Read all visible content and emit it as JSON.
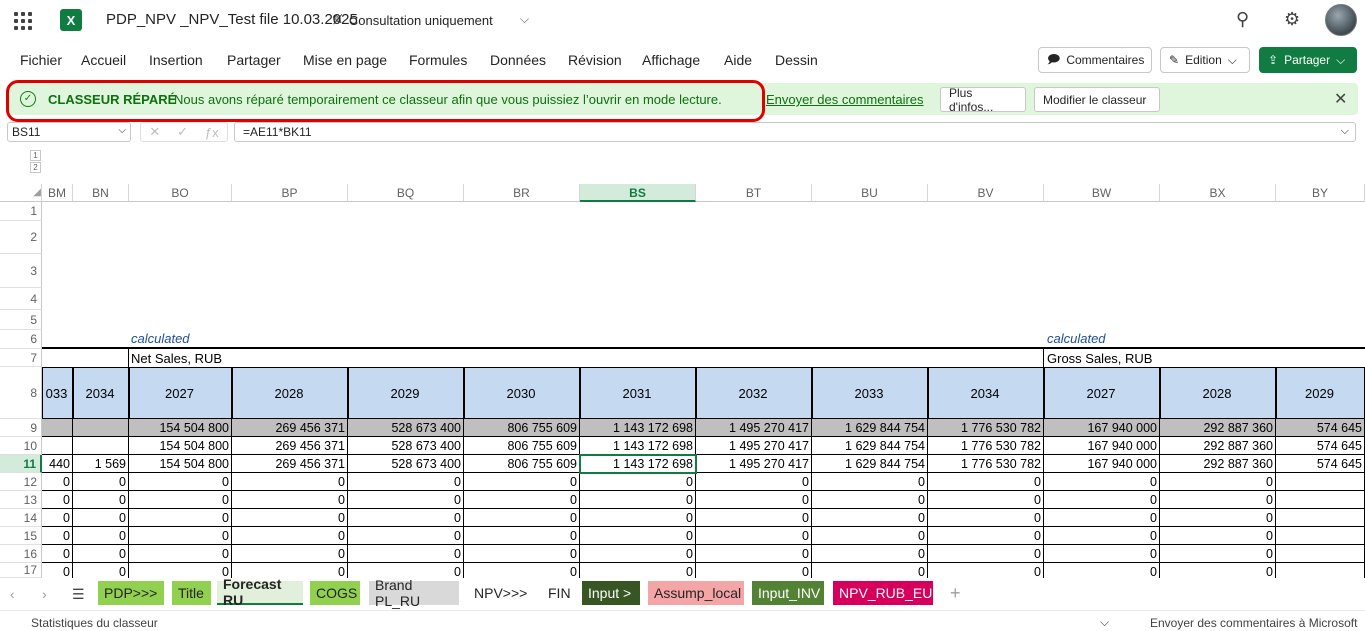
{
  "app": {
    "title": "PDP_NPV _NPV_Test file 10.03.2025",
    "view_mode": "Consultation uniquement"
  },
  "ribbon": {
    "tabs": [
      "Fichier",
      "Accueil",
      "Insertion",
      "Partager",
      "Mise en page",
      "Formules",
      "Données",
      "Révision",
      "Affichage",
      "Aide",
      "Dessin"
    ],
    "comments_label": "Commentaires",
    "edition_label": "Edition",
    "share_label": "Partager"
  },
  "banner": {
    "title": "CLASSEUR RÉPARÉ",
    "message": "Nous avons réparé temporairement ce classeur afin que vous puissiez l’ouvrir en mode lecture.",
    "link": "Envoyer des commentaires",
    "more_label": "Plus d'infos...",
    "modify_label": "Modifier le classeur"
  },
  "formula_bar": {
    "name_box": "BS11",
    "formula": "=AE11*BK11"
  },
  "outline_levels": [
    "1",
    "2"
  ],
  "columns": [
    "BM",
    "BN",
    "BO",
    "BP",
    "BQ",
    "BR",
    "BS",
    "BT",
    "BU",
    "BV",
    "BW",
    "BX",
    "BY"
  ],
  "rows": [
    "1",
    "2",
    "3",
    "4",
    "5",
    "6",
    "7",
    "8",
    "9",
    "10",
    "11",
    "12",
    "13",
    "14",
    "15",
    "16",
    "17"
  ],
  "sheet": {
    "calculated_1": "calculated",
    "calculated_2": "calculated",
    "net_sales": "Net Sales, RUB",
    "gross_sales": "Gross Sales, RUB",
    "years_row": [
      "033",
      "2034",
      "2027",
      "2028",
      "2029",
      "2030",
      "2031",
      "2032",
      "2033",
      "2034",
      "2027",
      "2028",
      "2029"
    ],
    "row9": [
      "",
      "",
      "154 504 800",
      "269 456 371",
      "528 673 400",
      "806 755 609",
      "1 143 172 698",
      "1 495 270 417",
      "1 629 844 754",
      "1 776 530 782",
      "167 940 000",
      "292 887 360",
      "574 645"
    ],
    "row10": [
      "",
      "",
      "154 504 800",
      "269 456 371",
      "528 673 400",
      "806 755 609",
      "1 143 172 698",
      "1 495 270 417",
      "1 629 844 754",
      "1 776 530 782",
      "167 940 000",
      "292 887 360",
      "574 645"
    ],
    "row11": [
      "440",
      "1 569",
      "154 504 800",
      "269 456 371",
      "528 673 400",
      "806 755 609",
      "1 143 172 698",
      "1 495 270 417",
      "1 629 844 754",
      "1 776 530 782",
      "167 940 000",
      "292 887 360",
      "574 645"
    ],
    "zero_rows": [
      "0",
      "0",
      "0",
      "0",
      "0",
      "0",
      "0",
      "0",
      "0",
      "0",
      "0",
      "0",
      ""
    ]
  },
  "sheet_tabs": [
    {
      "label": "PDP>>>",
      "bg": "#92d050"
    },
    {
      "label": "Title",
      "bg": "#92d050"
    },
    {
      "label": "Forecast RU",
      "bg": "#e2efda"
    },
    {
      "label": "COGS",
      "bg": "#92d050"
    },
    {
      "label": "Brand PL_RU",
      "bg": "#d9d9d9"
    },
    {
      "label": "NPV>>>",
      "bg": "#ffffff"
    },
    {
      "label": "FIN",
      "bg": "#ffffff"
    },
    {
      "label": "Input >",
      "bg": "#375623"
    },
    {
      "label": "Assump_local",
      "bg": "#f4a6a6"
    },
    {
      "label": "Input_INV",
      "bg": "#548235"
    },
    {
      "label": "NPV_RUB_EUR",
      "bg": "#d6005c"
    }
  ],
  "status": {
    "left": "Statistiques du classeur",
    "right": "Envoyer des commentaires à Microsoft"
  }
}
